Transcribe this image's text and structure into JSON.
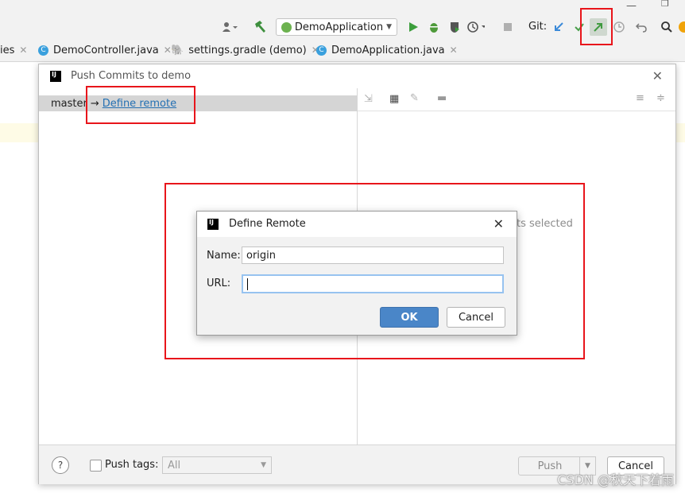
{
  "toolbar": {
    "run_config": "DemoApplication",
    "git_label": "Git:",
    "icons": [
      "user-icon",
      "hammer-icon",
      "run-icon",
      "debug-icon",
      "coverage-icon",
      "profile-icon",
      "stop-icon",
      "update-icon",
      "commit-icon",
      "push-icon",
      "history-icon",
      "rollback-icon",
      "search-icon"
    ]
  },
  "tabs": [
    {
      "label": "ies"
    },
    {
      "label": "DemoController.java"
    },
    {
      "label": "settings.gradle (demo)"
    },
    {
      "label": "DemoApplication.java"
    }
  ],
  "push_dialog": {
    "title": "Push Commits to demo",
    "branch": "master",
    "arrow": "→",
    "define_remote_link": "Define remote",
    "no_commits_text": "ts selected",
    "push_tags_label": "Push tags:",
    "tags_select_value": "All",
    "push_button": "Push",
    "cancel_button": "Cancel",
    "help_symbol": "?"
  },
  "remote_dialog": {
    "title": "Define Remote",
    "name_label": "Name:",
    "name_value": "origin",
    "url_label": "URL:",
    "url_value": "",
    "ok_button": "OK",
    "cancel_button": "Cancel"
  },
  "watermark": "CSDN @秋天下着雨",
  "colors": {
    "accent": "#4a86c8",
    "link": "#2470b3",
    "highlight_red": "#e8151b"
  }
}
